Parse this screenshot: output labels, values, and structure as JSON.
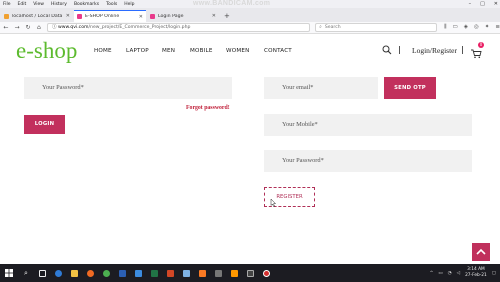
{
  "menubar": {
    "items": [
      "File",
      "Edit",
      "View",
      "History",
      "Bookmarks",
      "Tools",
      "Help"
    ],
    "watermark": "www.BANDICAM.com",
    "controls": [
      "–",
      "□",
      "✕"
    ]
  },
  "tabs": [
    {
      "label": "localhost / Local Databases / ...",
      "color": "#f0a030"
    },
    {
      "label": "E-SHOP Online",
      "color": "#e8398a"
    },
    {
      "label": "Login Page",
      "color": "#e8398a"
    }
  ],
  "toolbar": {
    "url_host": "www.qvi.com",
    "url_path": "/new_project/E_Commerce_Project/login.php",
    "search_placeholder": "Search"
  },
  "header": {
    "logo": "e-shop",
    "nav": [
      "HOME",
      "LAPTOP",
      "MEN",
      "MOBILE",
      "WOMEN",
      "CONTACT"
    ],
    "login_link": "Login/Register",
    "cart_count": "0"
  },
  "login_form": {
    "password_placeholder": "Your Password*",
    "forgot_link": "Forgot password!",
    "login_button": "LOGIN"
  },
  "register_form": {
    "email_placeholder": "Your email*",
    "otp_button": "SEND OTP",
    "mobile_placeholder": "Your Mobile*",
    "password_placeholder": "Your Password*",
    "register_button": "REGISTER"
  },
  "taskbar": {
    "time": "3:14 AM",
    "date": "27-Feb-21"
  },
  "colors": {
    "brand_green": "#5dbb2f",
    "accent_pink": "#c2305d"
  }
}
